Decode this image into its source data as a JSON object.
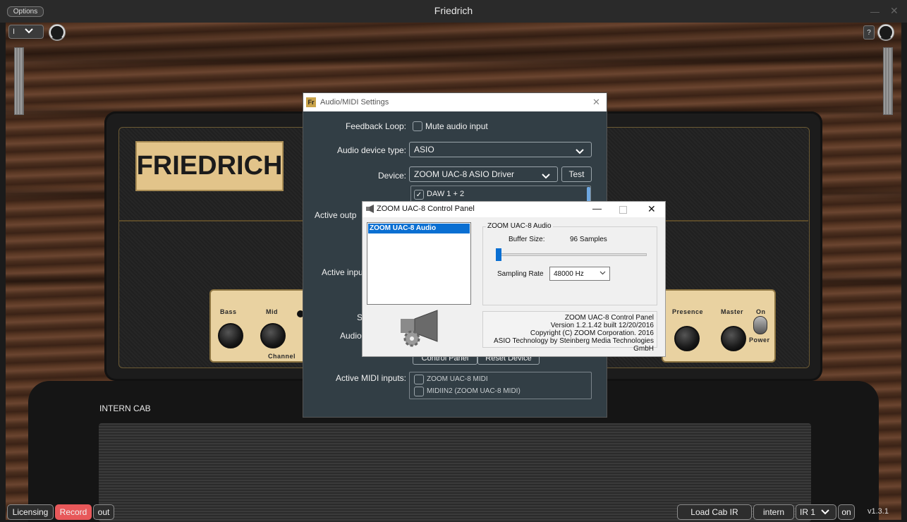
{
  "window": {
    "title": "Friedrich",
    "options_label": "Options",
    "preset_value": "I",
    "help_label": "?"
  },
  "amp": {
    "brand": "FRIEDRICH",
    "knobs_left": [
      "Bass",
      "Mid"
    ],
    "knobs_right": [
      "Presence",
      "Master"
    ],
    "switch_on_label": "On",
    "switch_power_label": "Power",
    "channel_label": "Channel"
  },
  "cab": {
    "label": "INTERN CAB"
  },
  "bottom_bar": {
    "licensing": "Licensing",
    "record": "Record",
    "out": "out",
    "load_cab_ir": "Load Cab IR",
    "intern": "intern",
    "ir_select": "IR 1",
    "on": "on",
    "version": "v1.3.1",
    "record_color": "#e8585a"
  },
  "audio_dialog": {
    "title": "Audio/MIDI Settings",
    "feedback_loop_label": "Feedback Loop:",
    "mute_audio_input": "Mute audio input",
    "device_type_label": "Audio device type:",
    "device_type_value": "ASIO",
    "device_label": "Device:",
    "device_value": "ZOOM UAC-8 ASIO Driver",
    "test_label": "Test",
    "output_item": "DAW 1 + 2",
    "active_outputs_label": "Active outp",
    "active_inputs_label": "Active inpu",
    "s_label": "S",
    "audio_label": "Audio",
    "control_panel": "Control Panel",
    "reset_device": "Reset Device",
    "active_midi_label": "Active MIDI inputs:",
    "midi_inputs": [
      "ZOOM UAC-8 MIDI",
      "MIDIIN2 (ZOOM UAC-8 MIDI)"
    ]
  },
  "zoom_panel": {
    "title": "ZOOM UAC-8 Control Panel",
    "list_item": "ZOOM UAC-8 Audio",
    "group_title": "ZOOM UAC-8 Audio",
    "buffer_size_label": "Buffer Size:",
    "buffer_size_value": "96 Samples",
    "buffer_slider_fraction": 0.03,
    "sampling_rate_label": "Sampling Rate",
    "sampling_rate_value": "48000 Hz",
    "info_lines": [
      "ZOOM UAC-8 Control Panel",
      "Version 1.2.1.42  built 12/20/2016",
      "Copyright (C) ZOOM Corporation. 2016",
      "ASIO Technology by Steinberg Media Technologies GmbH"
    ]
  }
}
